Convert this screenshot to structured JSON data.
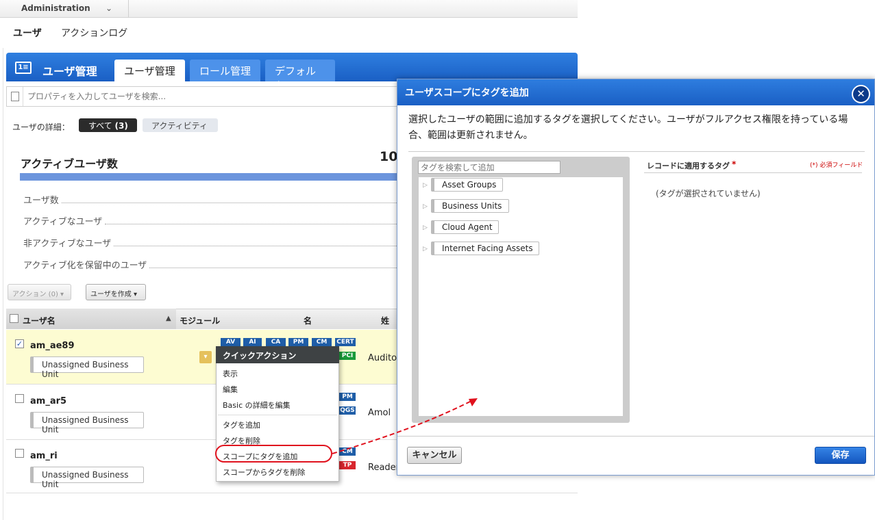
{
  "admin": {
    "label": "Administration"
  },
  "subnav": {
    "users": "ユーザ",
    "action_log": "アクションログ"
  },
  "header": {
    "icon_text": "1≡",
    "title": "ユーザ管理",
    "tabs": [
      {
        "label": "ユーザ管理",
        "active": true
      },
      {
        "label": "ロール管理",
        "active": false
      },
      {
        "label": "デフォルト",
        "active": false
      }
    ]
  },
  "search": {
    "placeholder": "プロパティを入力してユーザを検索..."
  },
  "details": {
    "label": "ユーザの詳細：",
    "all": "すべて",
    "all_count": "(3)",
    "activity": "アクティビティ"
  },
  "stats": {
    "title": "アクティブユーザ数",
    "count": "10",
    "rows": [
      "ユーザ数",
      "アクティブなユーザ",
      "非アクティブなユーザ",
      "アクティブ化を保留中のユーザ"
    ]
  },
  "toolbar": {
    "action": "アクション (0)",
    "create": "ユーザを作成"
  },
  "table": {
    "headers": {
      "username": "ユーザ名",
      "module": "モジュール",
      "first": "名",
      "last": "姓"
    },
    "rows": [
      {
        "username": "am_ae89",
        "bu": "Unassigned Business Unit",
        "last": "Auditor",
        "checked": true
      },
      {
        "username": "am_ar5",
        "bu": "Unassigned Business Unit",
        "last": "Amol",
        "checked": false
      },
      {
        "username": "am_ri",
        "bu": "Unassigned Business Unit",
        "last": "Reader",
        "checked": false
      }
    ],
    "modules": {
      "row1_line1": [
        "AV",
        "AI",
        "CA",
        "PM",
        "CM",
        "CERT"
      ],
      "row1_line2": [
        "PCI"
      ],
      "row2": [
        "PM",
        "QGS"
      ],
      "row3": [
        "CM",
        "TP"
      ]
    }
  },
  "quick_menu": {
    "title": "クイックアクション",
    "items": [
      "表示",
      "編集",
      "Basic の詳細を編集",
      "タグを追加",
      "タグを削除",
      "スコープにタグを追加",
      "スコープからタグを削除"
    ]
  },
  "dialog": {
    "title": "ユーザスコープにタグを追加",
    "close": "✕",
    "description": "選択したユーザの範囲に追加するタグを選択してください。ユーザがフルアクセス権限を持っている場合、範囲は更新されません。",
    "tag_search_placeholder": "タグを検索して追加",
    "tags": [
      "Asset Groups",
      "Business Units",
      "Cloud Agent",
      "Internet Facing Assets"
    ],
    "record_label": "レコードに適用するタグ",
    "required_star": "*",
    "required_note": "(*) 必須フィールド",
    "no_tags": "(タグが選択されていません)",
    "cancel": "キャンセル",
    "save": "保存"
  },
  "colors": {
    "accent": "#1a5fc4",
    "highlight": "#e0111d",
    "selected_row": "#fdfcd2"
  }
}
